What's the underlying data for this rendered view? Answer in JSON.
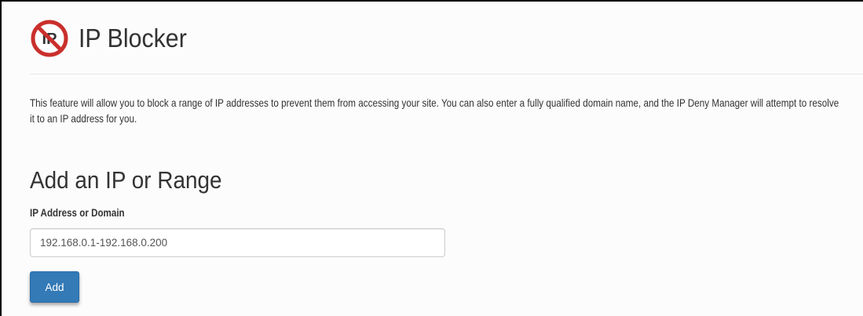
{
  "header": {
    "title": "IP Blocker",
    "logo_icon": "ip-blocker-icon",
    "logo_text": "IP"
  },
  "description": "This feature will allow you to block a range of IP addresses to prevent them from accessing your site. You can also enter a fully qualified domain name, and the IP Deny Manager will attempt to resolve it to an IP address for you.",
  "add_section": {
    "title": "Add an IP or Range",
    "field_label": "IP Address or Domain",
    "field_value": "192.168.0.1-192.168.0.200",
    "add_label": "Add"
  },
  "colors": {
    "accent": "#337ab7",
    "prohibit_red": "#c9302c"
  }
}
